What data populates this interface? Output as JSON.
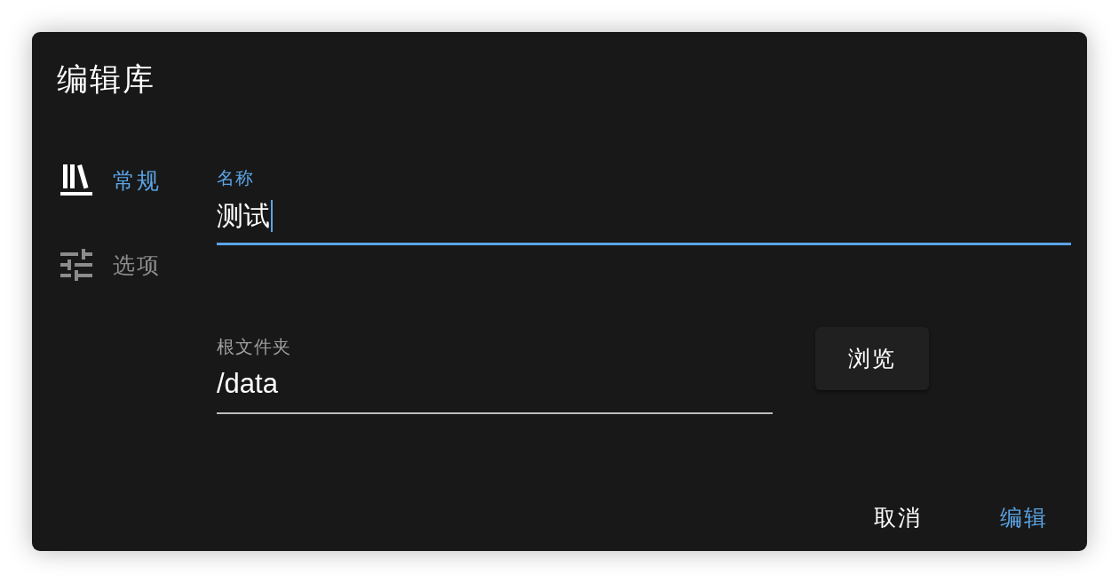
{
  "dialog": {
    "title": "编辑库"
  },
  "sidebar": {
    "items": [
      {
        "label": "常规",
        "selected": true
      },
      {
        "label": "选项",
        "selected": false
      }
    ]
  },
  "fields": [
    {
      "label": "名称",
      "value": "测试",
      "focused": true
    },
    {
      "label": "根文件夹",
      "value": "/data",
      "focused": false,
      "button": "浏览"
    }
  ],
  "actions": [
    {
      "label": "取消",
      "kind": "secondary"
    },
    {
      "label": "编辑",
      "kind": "primary"
    }
  ]
}
